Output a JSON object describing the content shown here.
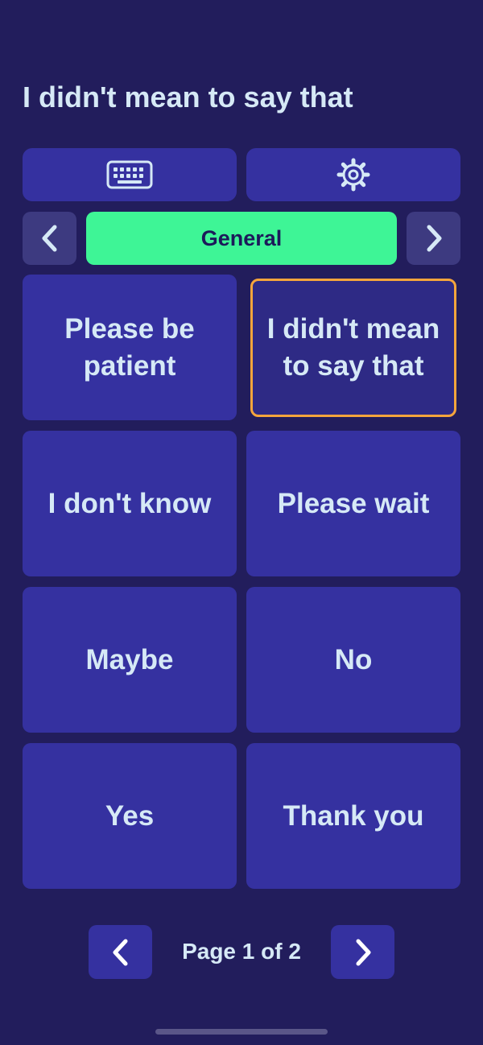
{
  "header": {
    "spoken_text": "I didn't mean to say that"
  },
  "toolbar": {
    "keyboard_icon": "keyboard-icon",
    "settings_icon": "gear-icon"
  },
  "category_nav": {
    "current": "General",
    "prev_icon": "chevron-left-icon",
    "next_icon": "chevron-right-icon"
  },
  "phrases": [
    {
      "label": "Please be patient",
      "selected": false
    },
    {
      "label": "I didn't mean to say that",
      "selected": true
    },
    {
      "label": "I don't know",
      "selected": false
    },
    {
      "label": "Please wait",
      "selected": false
    },
    {
      "label": "Maybe",
      "selected": false
    },
    {
      "label": "No",
      "selected": false
    },
    {
      "label": "Yes",
      "selected": false
    },
    {
      "label": "Thank you",
      "selected": false
    }
  ],
  "pagination": {
    "label": "Page 1 of 2",
    "current_page": 1,
    "total_pages": 2
  },
  "colors": {
    "background": "#221d5c",
    "tile": "#3531a0",
    "accent_green": "#3ef596",
    "selection_border": "#f5a53c",
    "text": "#d6e9f6"
  }
}
